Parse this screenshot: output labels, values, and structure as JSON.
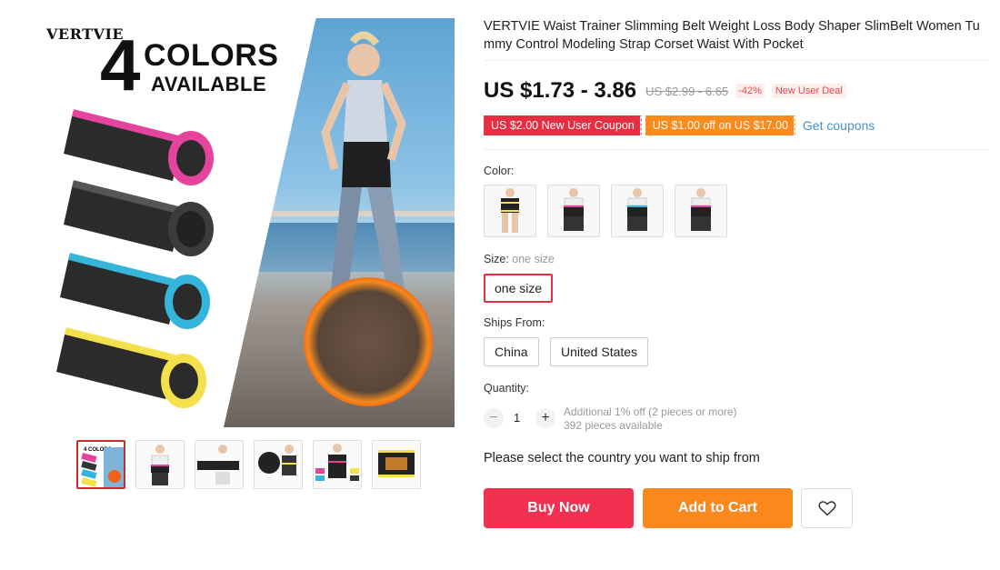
{
  "gallery": {
    "main_image": {
      "brand": "VERTVIE",
      "promo_number": "4",
      "promo_line1": "COLORS",
      "promo_line2": "AVAILABLE",
      "roll_colors": [
        "#e5449d",
        "#3a3a3a",
        "#35b4dc",
        "#f3e04a"
      ]
    },
    "thumbnails": [
      {
        "label": "4 COLORS",
        "active": true
      },
      {
        "active": false
      },
      {
        "active": false
      },
      {
        "active": false
      },
      {
        "active": false
      },
      {
        "active": false
      }
    ]
  },
  "product": {
    "title": "VERTVIE Waist Trainer Slimming Belt Weight Loss Body Shaper SlimBelt Women Tummy Control Modeling Strap Corset Waist With Pocket",
    "price": "US $1.73 - 3.86",
    "original_price": "US $2.99 - 6.65",
    "discount": "-42%",
    "deal_badge": "New User Deal",
    "coupons": [
      "US $2.00 New User Coupon",
      "US $1.00 off on US $17.00"
    ],
    "get_coupons": "Get coupons"
  },
  "options": {
    "color_label": "Color:",
    "color_swatches": [
      "#f3e04a",
      "#e5449d",
      "#35b4dc",
      "#e5449d"
    ],
    "size_label": "Size:",
    "size_selected_text": "one size",
    "sizes": [
      "one size"
    ],
    "ships_from_label": "Ships From:",
    "ships_from": [
      "China",
      "United States"
    ],
    "quantity_label": "Quantity:",
    "quantity": "1",
    "quantity_minus": "−",
    "quantity_plus": "+",
    "quantity_note1": "Additional 1% off (2 pieces or more)",
    "quantity_note2": "392 pieces available"
  },
  "ship_message": "Please select the country you want to ship from",
  "actions": {
    "buy_now": "Buy Now",
    "add_to_cart": "Add to Cart",
    "wishlist_icon": "heart-icon"
  },
  "colors": {
    "accent_red": "#f2304f",
    "accent_orange": "#f9891d",
    "link_blue": "#4a90c9"
  }
}
